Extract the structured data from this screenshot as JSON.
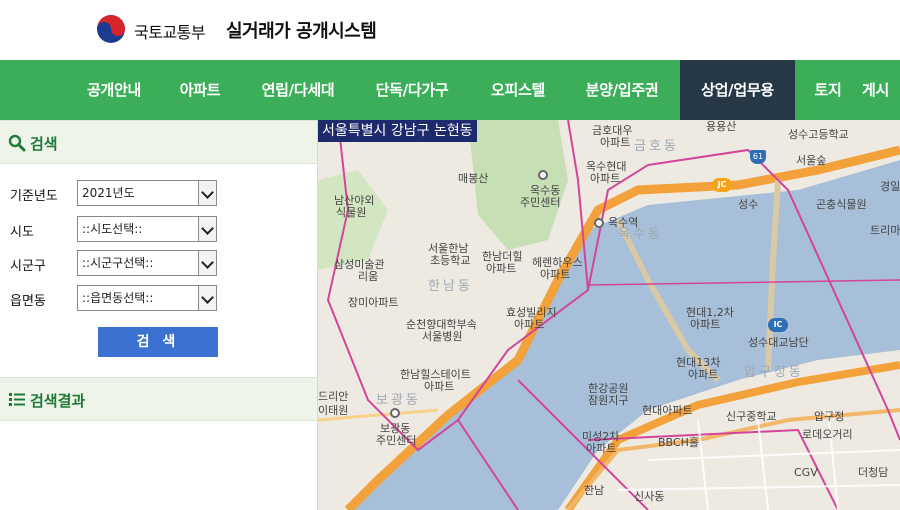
{
  "header": {
    "ministry": "국토교통부",
    "system_name": "실거래가 공개시스템",
    "logo_icon": "taegeuk-logo-icon"
  },
  "nav": {
    "items": [
      {
        "label": "공개안내"
      },
      {
        "label": "아파트"
      },
      {
        "label": "연립/다세대"
      },
      {
        "label": "단독/다가구"
      },
      {
        "label": "오피스텔"
      },
      {
        "label": "분양/입주권"
      },
      {
        "label": "상업/업무용"
      },
      {
        "label": "토지"
      },
      {
        "label": "게시"
      }
    ],
    "active_index": 6
  },
  "search": {
    "title": "검색",
    "icon": "search-icon",
    "fields": [
      {
        "label": "기준년도",
        "value": "2021년도"
      },
      {
        "label": "시도",
        "value": "::시도선택::"
      },
      {
        "label": "시군구",
        "value": "::시군구선택::"
      },
      {
        "label": "읍면동",
        "value": "::읍면동선택::"
      }
    ],
    "button_label": "검 색"
  },
  "results": {
    "title": "검색결과",
    "icon": "list-icon"
  },
  "map": {
    "location_title": "서울특별시 강남구 논현동",
    "labels": [
      "금호대우",
      "아파트",
      "옥수현대",
      "아파트",
      "옥수동",
      "주민센터",
      "옥수역",
      "매봉산",
      "남산야외",
      "식물원",
      "서울한남",
      "초등학교",
      "한남더힐",
      "아파트",
      "헤렌하우스",
      "아파트",
      "삼성미술관",
      "리움",
      "장미아파트",
      "효성빌리지",
      "아파트",
      "순천향대학부속",
      "서울병원",
      "한남힐스테이트",
      "아파트",
      "보광동",
      "주민센터",
      "한강공원",
      "잠원지구",
      "현대아파트",
      "미성2차",
      "아파트",
      "BBCH홀",
      "신사동",
      "성수고등학교",
      "서울숲",
      "성수",
      "곤충식물원",
      "현대1,2차",
      "아파트",
      "성수대교남단",
      "현대13차",
      "아파트",
      "신구중학교",
      "압구정",
      "로데오거리",
      "CGV",
      "더청담",
      "트리마",
      "경일",
      "한남동",
      "보광동",
      "옥수동",
      "한남",
      "압구정동",
      "금호동",
      "용용산",
      "이태원",
      "드리안"
    ],
    "badges": {
      "jc": "JC",
      "ic": "IC",
      "route": "61"
    }
  },
  "colors": {
    "nav_green": "#3cae5a",
    "nav_active": "#263746",
    "button_blue": "#3b72d1",
    "panel_bg": "#eef5e8",
    "map_title_bg": "#1e2a6e",
    "river": "#a7bfd8",
    "road_orange": "#f3a13b",
    "district_border": "#d3459a"
  }
}
